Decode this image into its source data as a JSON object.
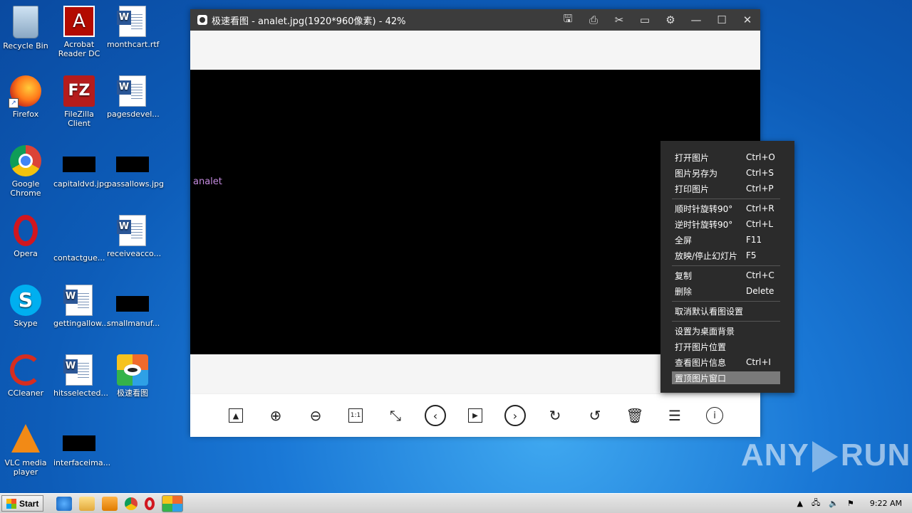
{
  "desktop": {
    "icons": [
      {
        "label": "Recycle Bin",
        "icon": "recycle-bin-icon"
      },
      {
        "label": "Acrobat Reader DC",
        "icon": "acrobat-icon"
      },
      {
        "label": "monthcart.rtf",
        "icon": "word-doc-icon"
      },
      {
        "label": "Firefox",
        "icon": "firefox-icon"
      },
      {
        "label": "FileZilla Client",
        "icon": "filezilla-icon"
      },
      {
        "label": "pagesdevel...",
        "icon": "word-doc-icon"
      },
      {
        "label": "Google Chrome",
        "icon": "chrome-icon"
      },
      {
        "label": "capitaldvd.jpg",
        "icon": "image-file-icon"
      },
      {
        "label": "passallows.jpg",
        "icon": "image-file-icon"
      },
      {
        "label": "Opera",
        "icon": "opera-icon"
      },
      {
        "label": "contactgue...",
        "icon": "blank-file-icon"
      },
      {
        "label": "receiveacco...",
        "icon": "word-doc-icon"
      },
      {
        "label": "Skype",
        "icon": "skype-icon"
      },
      {
        "label": "gettingallow...",
        "icon": "word-doc-icon"
      },
      {
        "label": "smallmanuf...",
        "icon": "image-file-icon"
      },
      {
        "label": "CCleaner",
        "icon": "ccleaner-icon"
      },
      {
        "label": "hitsselected...",
        "icon": "word-doc-icon"
      },
      {
        "label": "极速看图",
        "icon": "image-viewer-app-icon"
      },
      {
        "label": "VLC media player",
        "icon": "vlc-icon"
      },
      {
        "label": "interfaceima...",
        "icon": "image-file-icon"
      }
    ]
  },
  "window": {
    "title": "极速看图 - analet.jpg(1920*960像素) - 42%",
    "image_alt": "analet",
    "title_buttons": [
      "save-icon",
      "print-icon",
      "cut-icon",
      "feedback-icon",
      "settings-icon",
      "minimize-icon",
      "maximize-icon",
      "close-icon"
    ],
    "toolbar": [
      "open-image-icon",
      "zoom-in-icon",
      "zoom-out-icon",
      "actual-size-icon",
      "fit-window-icon",
      "previous-icon",
      "slideshow-icon",
      "next-icon",
      "rotate-clockwise-icon",
      "rotate-counterclockwise-icon",
      "delete-icon",
      "menu-icon",
      "info-icon"
    ],
    "actual_size_label": "1:1"
  },
  "context_menu": {
    "items": [
      {
        "label": "打开图片",
        "shortcut": "Ctrl+O"
      },
      {
        "label": "图片另存为",
        "shortcut": "Ctrl+S"
      },
      {
        "label": "打印图片",
        "shortcut": "Ctrl+P"
      },
      {
        "label": "顺时针旋转90°",
        "shortcut": "Ctrl+R"
      },
      {
        "label": "逆时针旋转90°",
        "shortcut": "Ctrl+L"
      },
      {
        "label": "全屏",
        "shortcut": "F11"
      },
      {
        "label": "放映/停止幻灯片",
        "shortcut": "F5"
      },
      {
        "label": "复制",
        "shortcut": "Ctrl+C"
      },
      {
        "label": "删除",
        "shortcut": "Delete"
      },
      {
        "label": "取消默认看图设置",
        "shortcut": ""
      },
      {
        "label": "设置为桌面背景",
        "shortcut": ""
      },
      {
        "label": "打开图片位置",
        "shortcut": ""
      },
      {
        "label": "查看图片信息",
        "shortcut": "Ctrl+I"
      },
      {
        "label": "置顶图片窗口",
        "shortcut": ""
      }
    ],
    "highlighted": "置顶图片窗口"
  },
  "watermark": {
    "left": "ANY",
    "right": "RUN"
  },
  "taskbar": {
    "start_label": "Start",
    "clock": "9:22 AM",
    "pinned": [
      "ie-icon",
      "explorer-icon",
      "media-player-icon",
      "chrome-icon",
      "opera-icon",
      "image-viewer-app-icon"
    ]
  }
}
